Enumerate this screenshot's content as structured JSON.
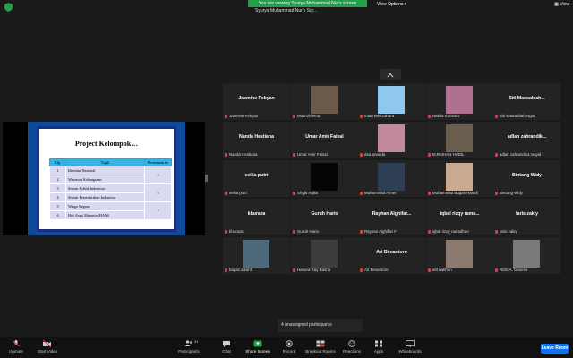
{
  "top_bar": {
    "banner_text": "You are viewing Syurya Muhammad Nur's screen",
    "presenter_label": "Syurya Muhammad Nur's Scr...",
    "view_options": "View Options",
    "view": "View"
  },
  "slide": {
    "title": "Project Kelompok…",
    "headers": [
      "Klp.",
      "Topik",
      "Pertemuan ke"
    ],
    "rows": [
      {
        "klp": "1",
        "topik": "Identitas Nasional"
      },
      {
        "klp": "2",
        "topik": "Wawasan Kebangsaan"
      },
      {
        "klp": "3",
        "topik": "Sistem Politik Indonesia"
      },
      {
        "klp": "4",
        "topik": "Sistem Pemerintahan Indonesia"
      },
      {
        "klp": "5",
        "topik": "Warga Negara"
      },
      {
        "klp": "6",
        "topik": "Hak Asasi Manusia (HAM)"
      }
    ],
    "pertemuan": [
      "3",
      "5",
      "7"
    ]
  },
  "participants": [
    {
      "big": "Jasmine Febyan",
      "label": "Jasmine Febyan"
    },
    {
      "big": "",
      "label": "Mia Azhiema",
      "pic": "#6b5a4a"
    },
    {
      "big": "",
      "label": "Intan Mei Zahara",
      "pic": "#8ec8f0"
    },
    {
      "big": "",
      "label": "Nabila Karisma",
      "pic": "#b07090"
    },
    {
      "big": "Siti  Mawaddah...",
      "label": "Siti Mawaddah Ngiu"
    },
    {
      "big": "Nanda Hestiana",
      "label": "Nanda Hestiana"
    },
    {
      "big": "Umar Amir Faisal",
      "label": "Umar Amir Faisal"
    },
    {
      "big": "",
      "label": "dea ananda",
      "pic": "#c08a9a"
    },
    {
      "big": "",
      "label": "M.RAIHAN HADIL",
      "pic": "#6a5e4e"
    },
    {
      "big": "adlan  zahrandik...",
      "label": "adlan zahrandika rasyid"
    },
    {
      "big": "sellia putri",
      "label": "sellia putri"
    },
    {
      "big": "",
      "label": "Shyfa Aqilla",
      "pic": "#050505"
    },
    {
      "big": "",
      "label": "Muhammad Almer",
      "pic": "#2e3e55"
    },
    {
      "big": "",
      "label": "Muhammad Bagas Hanafi",
      "pic": "#c9a990"
    },
    {
      "big": "Bintang Widy",
      "label": "Bintang Widy"
    },
    {
      "big": "khuraza",
      "label": "khuraza"
    },
    {
      "big": "Guruh Hario",
      "label": "Guruh Hario"
    },
    {
      "big": "Rayhan  Alghifar...",
      "label": "Rayhan Alghifari F"
    },
    {
      "big": "iqbal rizqy rama...",
      "label": "iqbal rizqy ramadhan"
    },
    {
      "big": "faris zakiy",
      "label": "faris zakiy"
    },
    {
      "big": "",
      "label": "bagas alkahfi",
      "pic": "#4e6a7a"
    },
    {
      "big": "",
      "label": "Hanura Ray Basha",
      "pic": "#3d3d3d"
    },
    {
      "big": "Ari Bimantoro",
      "label": "Ari Bimantoro"
    },
    {
      "big": "",
      "label": "afif nabhan",
      "pic": "#8a7a70"
    },
    {
      "big": "",
      "label": "Rizki A. Ganesa",
      "pic": "#7a7a7a"
    }
  ],
  "unassigned": "4 unassigned participants",
  "toolbar": {
    "unmute": "Unmute",
    "start_video": "Start Video",
    "participants": "Participants",
    "participants_count": "31",
    "chat": "Chat",
    "share_screen": "Share Screen",
    "record": "Record",
    "breakout_rooms": "Breakout Rooms",
    "reactions": "Reactions",
    "apps": "Apps",
    "whiteboards": "Whiteboards",
    "leave_room": "Leave Room"
  },
  "colors": {
    "share_green": "#23a04a",
    "leave_blue": "#0e72ed",
    "mute_red": "#e03b3b"
  }
}
